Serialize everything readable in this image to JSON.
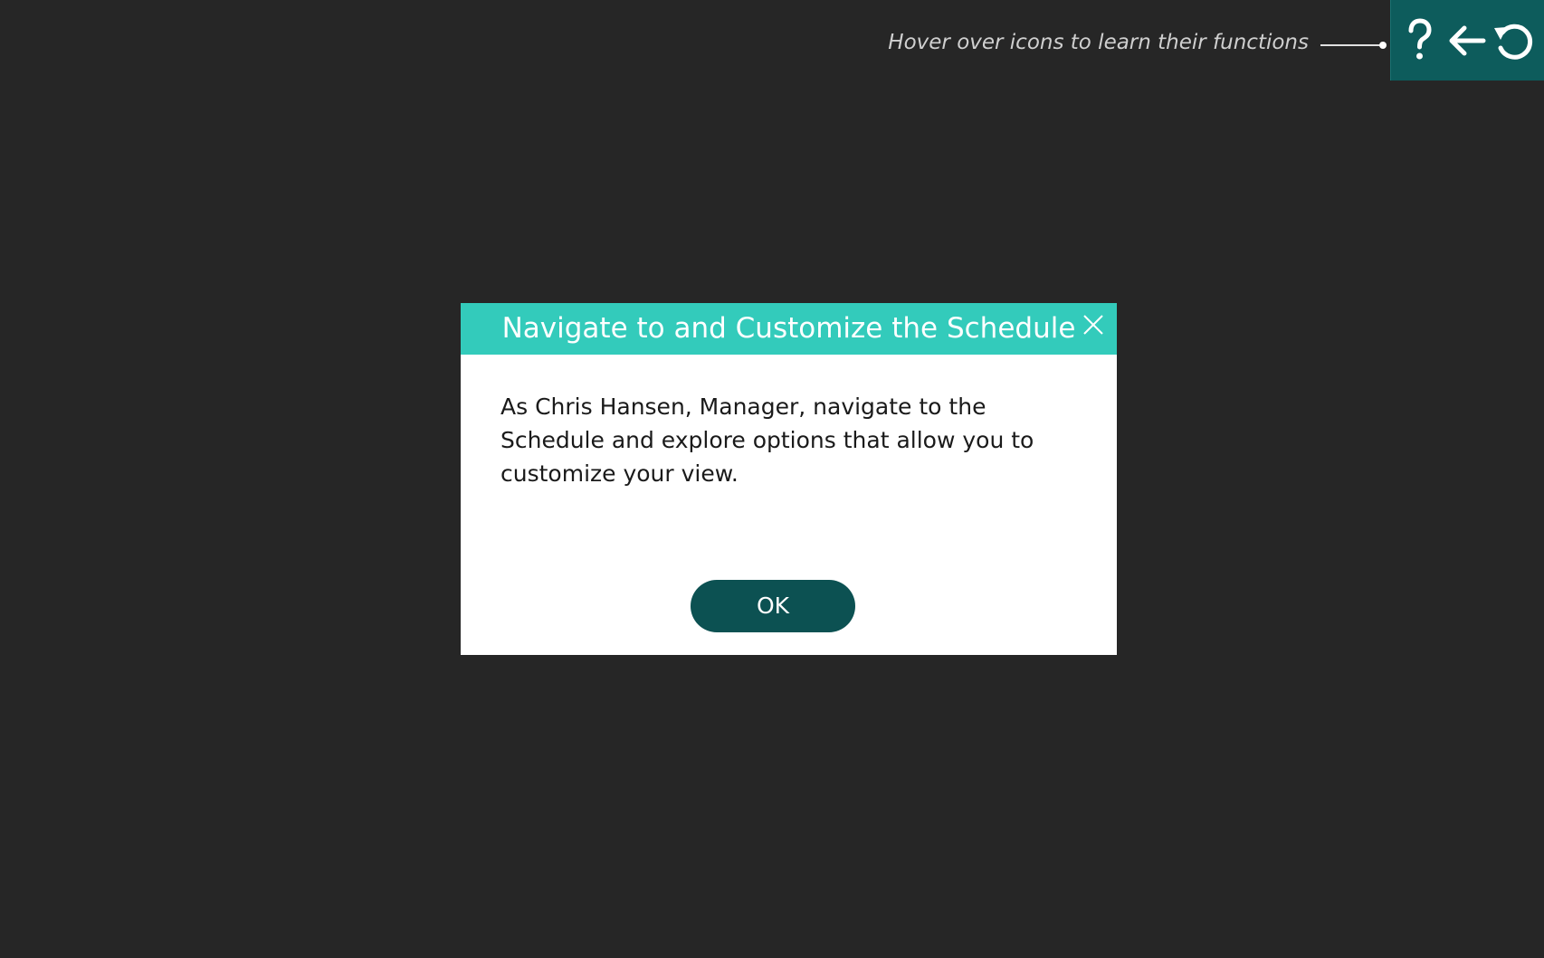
{
  "hint": {
    "text": "Hover over icons to learn their functions"
  },
  "toolbar": {
    "buttons": [
      {
        "icon": "question-mark-icon",
        "label": "Help"
      },
      {
        "icon": "arrow-left-icon",
        "label": "Back"
      },
      {
        "icon": "reset-icon",
        "label": "Reset"
      }
    ],
    "background": "#0d5c5c"
  },
  "dialog": {
    "title": "Navigate to and Customize the Schedule",
    "message": "As Chris Hansen, Manager, navigate to the Schedule and explore options that allow you to customize your view.",
    "ok_label": "OK",
    "header_color": "#33cbbb",
    "button_color": "#0c5152"
  },
  "colors": {
    "page_background": "#262626"
  }
}
